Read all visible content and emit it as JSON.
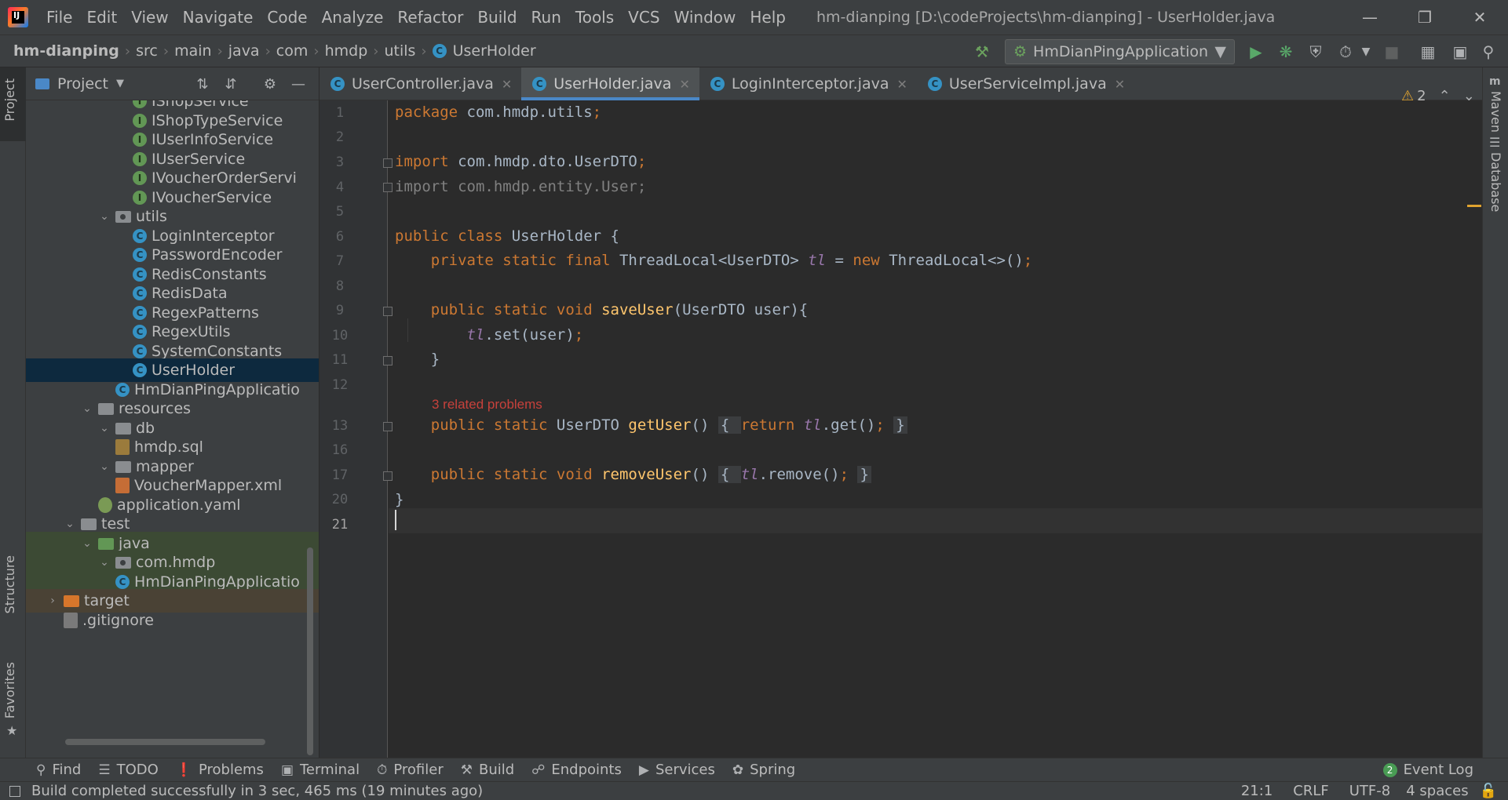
{
  "menubar": {
    "items": [
      "File",
      "Edit",
      "View",
      "Navigate",
      "Code",
      "Analyze",
      "Refactor",
      "Build",
      "Run",
      "Tools",
      "VCS",
      "Window",
      "Help"
    ],
    "window_title": "hm-dianping [D:\\codeProjects\\hm-dianping] - UserHolder.java",
    "logo_text": "IJ"
  },
  "navbar": {
    "crumbs": [
      "hm-dianping",
      "src",
      "main",
      "java",
      "com",
      "hmdp",
      "utils",
      "UserHolder"
    ],
    "run_config": "HmDianPingApplication"
  },
  "left_strip": {
    "project": "Project",
    "structure": "Structure",
    "favorites": "Favorites"
  },
  "right_strip": {
    "maven": "Maven",
    "database": "Database"
  },
  "project_panel": {
    "title": "Project",
    "tree": [
      {
        "label": "IShopService",
        "kind": "interface"
      },
      {
        "label": "IShopTypeService",
        "kind": "interface"
      },
      {
        "label": "IUserInfoService",
        "kind": "interface"
      },
      {
        "label": "IUserService",
        "kind": "interface"
      },
      {
        "label": "IVoucherOrderServi",
        "kind": "interface"
      },
      {
        "label": "IVoucherService",
        "kind": "interface"
      },
      {
        "label": "utils",
        "kind": "package"
      },
      {
        "label": "LoginInterceptor",
        "kind": "class"
      },
      {
        "label": "PasswordEncoder",
        "kind": "class"
      },
      {
        "label": "RedisConstants",
        "kind": "class"
      },
      {
        "label": "RedisData",
        "kind": "class"
      },
      {
        "label": "RegexPatterns",
        "kind": "class"
      },
      {
        "label": "RegexUtils",
        "kind": "class"
      },
      {
        "label": "SystemConstants",
        "kind": "class"
      },
      {
        "label": "UserHolder",
        "kind": "class"
      },
      {
        "label": "HmDianPingApplicatio",
        "kind": "springclass"
      },
      {
        "label": "resources",
        "kind": "folder"
      },
      {
        "label": "db",
        "kind": "folder"
      },
      {
        "label": "hmdp.sql",
        "kind": "sql"
      },
      {
        "label": "mapper",
        "kind": "folder"
      },
      {
        "label": "VoucherMapper.xml",
        "kind": "xml"
      },
      {
        "label": "application.yaml",
        "kind": "yaml"
      },
      {
        "label": "test",
        "kind": "folder"
      },
      {
        "label": "java",
        "kind": "testfolder"
      },
      {
        "label": "com.hmdp",
        "kind": "package"
      },
      {
        "label": "HmDianPingApplicatio",
        "kind": "class"
      },
      {
        "label": "target",
        "kind": "excluded"
      },
      {
        "label": ".gitignore",
        "kind": "git"
      }
    ]
  },
  "editor_tabs": [
    {
      "label": "UserController.java",
      "active": false
    },
    {
      "label": "UserHolder.java",
      "active": true
    },
    {
      "label": "LoginInterceptor.java",
      "active": false
    },
    {
      "label": "UserServiceImpl.java",
      "active": false
    }
  ],
  "editor": {
    "line_numbers": [
      "1",
      "2",
      "3",
      "4",
      "5",
      "6",
      "7",
      "8",
      "9",
      "10",
      "11",
      "12",
      "13",
      "16",
      "17",
      "20",
      "21"
    ],
    "code": {
      "l1a": "package ",
      "l1b": "com.hmdp.utils",
      "l1c": ";",
      "l3a": "import ",
      "l3b": "com.hmdp.dto.UserDTO",
      "l3c": ";",
      "l4": "import com.hmdp.entity.User;",
      "l6a": "public class ",
      "l6b": "UserHolder {",
      "l7a": "    private static final ",
      "l7b": "ThreadLocal<UserDTO> ",
      "l7c": "tl",
      "l7d": " = ",
      "l7e": "new ",
      "l7f": "ThreadLocal<>()",
      "l7g": ";",
      "l9a": "    public static void ",
      "l9b": "saveUser",
      "l9c": "(UserDTO user){",
      "l10a": "        ",
      "l10b": "tl",
      "l10c": ".set(user)",
      "l10d": ";",
      "l11": "    }",
      "hint": "3 related problems",
      "l13a": "    public static ",
      "l13b": "UserDTO ",
      "l13c": "getUser",
      "l13d": "() ",
      "l13e": "{ ",
      "l13f": "return ",
      "l13g": "tl",
      "l13h": ".get()",
      "l13i": "; ",
      "l13j": "}",
      "l17a": "    public static void ",
      "l17b": "removeUser",
      "l17c": "() ",
      "l17d": "{ ",
      "l17e": "tl",
      "l17f": ".remove()",
      "l17g": "; ",
      "l17h": "}",
      "l20": "}"
    },
    "warning_count": "2"
  },
  "toolwindows": [
    "Find",
    "TODO",
    "Problems",
    "Terminal",
    "Profiler",
    "Build",
    "Endpoints",
    "Services",
    "Spring"
  ],
  "event_log": {
    "count": "2",
    "label": "Event Log"
  },
  "statusbar": {
    "message": "Build completed successfully in 3 sec, 465 ms (19 minutes ago)",
    "position": "21:1",
    "line_sep": "CRLF",
    "encoding": "UTF-8",
    "indent": "4 spaces"
  },
  "colors": {
    "accent": "#4a88c7",
    "selection": "#0d293e",
    "keyword": "#cc7832",
    "field": "#9876aa",
    "method": "#ffc66d",
    "error": "#c7413b"
  }
}
